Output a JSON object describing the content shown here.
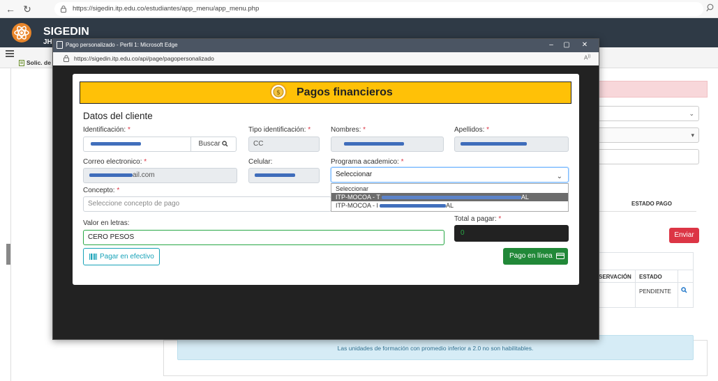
{
  "browser": {
    "url": "https://sigedin.itp.edu.co/estudiantes/app_menu/app_menu.php"
  },
  "app": {
    "name": "SIGEDIN",
    "user_fragment": "JH",
    "breadcrumb": "Solic. de"
  },
  "background": {
    "estado_pago_header": "ESTADO PAGO",
    "enviar_label": "Enviar",
    "table_headers": [
      "SERVACIÓN",
      "ESTADO"
    ],
    "table_row": {
      "estado": "PENDIENTE"
    },
    "info_message": "Las unidades de formación con promedio inferior a 2.0 no son habilitables."
  },
  "popup": {
    "title": "Pago personalizado - Perfil 1: Microsoft Edge",
    "url": "https://sigedin.itp.edu.co/api/page/pagopersonalizado",
    "controls": {
      "minimize": "–",
      "restore": "▢",
      "close": "✕"
    }
  },
  "modal": {
    "title": "Pagos financieros",
    "section_title": "Datos del cliente",
    "fields": {
      "identificacion": {
        "label": "Identificación:",
        "required": "*"
      },
      "tipo_identificacion": {
        "label": "Tipo identificación:",
        "required": "*",
        "value": "CC"
      },
      "nombres": {
        "label": "Nombres:",
        "required": "*"
      },
      "apellidos": {
        "label": "Apellidos:",
        "required": "*"
      },
      "correo": {
        "label": "Correo electronico:",
        "required": "*",
        "value_suffix": "ail.com"
      },
      "celular": {
        "label": "Celular:"
      },
      "programa": {
        "label": "Programa academico:",
        "required": "*",
        "value": "Seleccionar"
      },
      "concepto": {
        "label": "Concepto:",
        "required": "*",
        "placeholder": "Seleccione concepto de pago"
      },
      "valor_letras": {
        "label": "Valor en letras:",
        "value": "CERO PESOS"
      },
      "total": {
        "label": "Total a pagar:",
        "required": "*",
        "value": "0"
      }
    },
    "buscar_label": "Buscar",
    "dropdown_options": [
      {
        "label": "Seleccionar",
        "selected": false
      },
      {
        "label": "ITP-MOCOA - T",
        "selected": true
      },
      {
        "label": "ITP-MOCOA - I",
        "selected": false
      }
    ],
    "dropdown_option_suffix": "AL",
    "btn_efectivo": "Pagar en efectivo",
    "btn_linea": "Pago en línea"
  },
  "colors": {
    "header_yellow": "#ffc107",
    "app_header": "#2f3a46",
    "success": "#218838",
    "info": "#17a2b8",
    "danger": "#dc3545"
  }
}
